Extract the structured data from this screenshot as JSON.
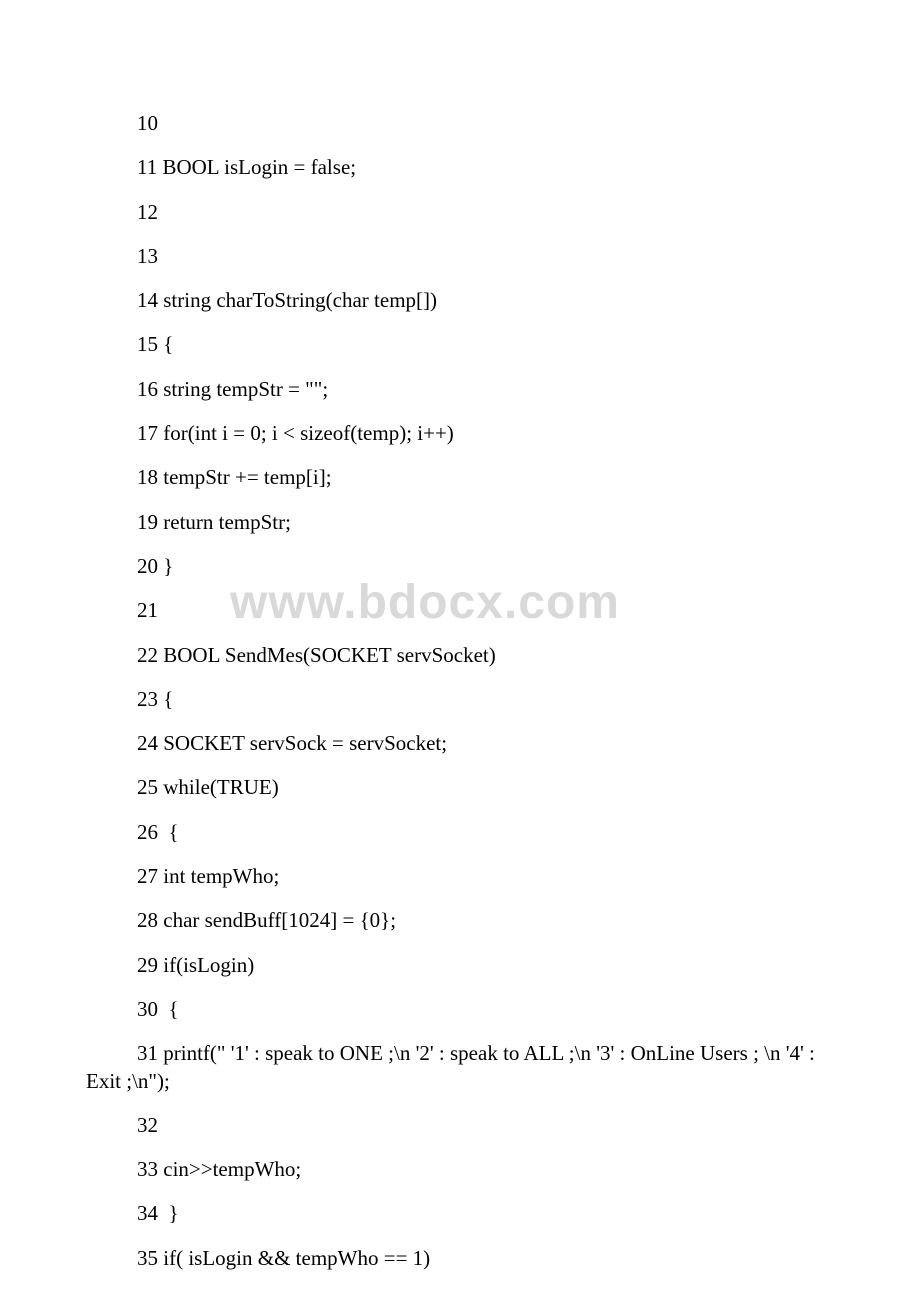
{
  "watermark": "www.bdocx.com",
  "lines": {
    "l10": "10",
    "l11": "11 BOOL isLogin = false;",
    "l12": "12",
    "l13": "13",
    "l14": "14 string charToString(char temp[])",
    "l15": "15 {",
    "l16": "16 string tempStr = \"\";",
    "l17": "17 for(int i = 0; i < sizeof(temp); i++)",
    "l18": "18 tempStr += temp[i];",
    "l19": "19 return tempStr;",
    "l20": "20 }",
    "l21": "21",
    "l22": "22 BOOL SendMes(SOCKET servSocket)",
    "l23": "23 {",
    "l24": "24 SOCKET servSock = servSocket;",
    "l25": "25 while(TRUE)",
    "l26": "26  {",
    "l27": "27 int tempWho;",
    "l28": "28 char sendBuff[1024] = {0};",
    "l29": "29 if(isLogin)",
    "l30": "30  {",
    "l31": "31 printf(\" '1' : speak to ONE ;\\n '2' : speak to ALL ;\\n '3' : OnLine Users ; \\n '4' : Exit ;\\n\");",
    "l32": "32",
    "l33": "33 cin>>tempWho;",
    "l34": "34  }",
    "l35": "35 if( isLogin && tempWho == 1)"
  }
}
